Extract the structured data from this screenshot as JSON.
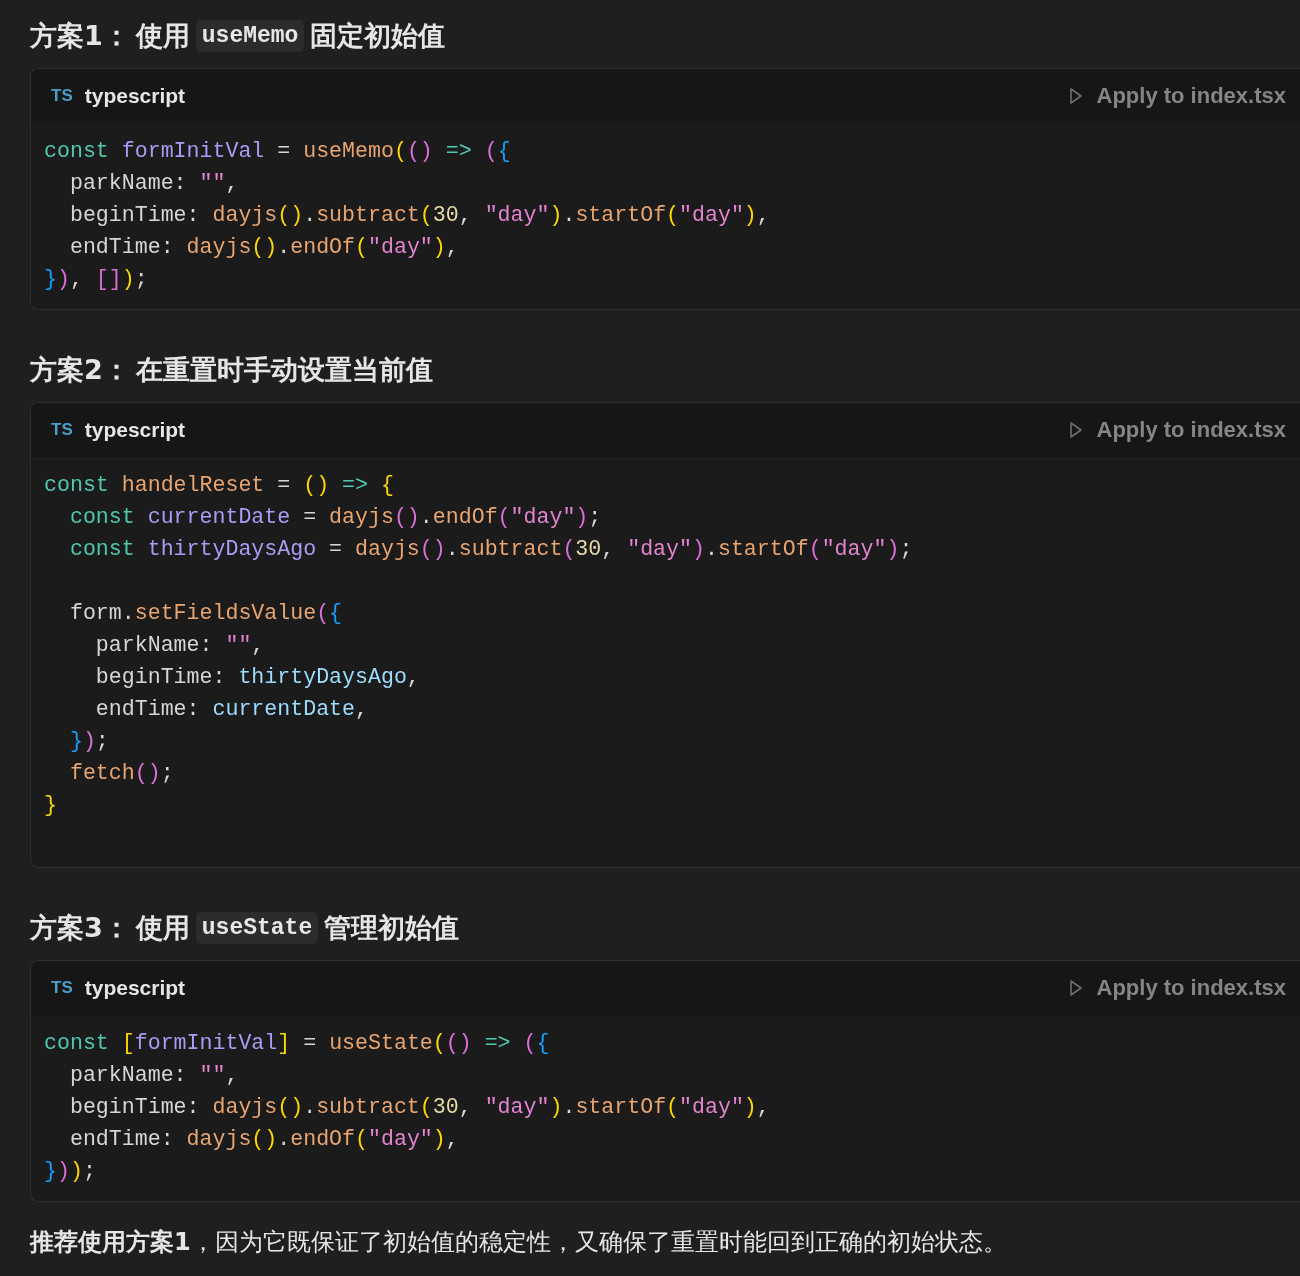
{
  "sections": [
    {
      "heading": [
        {
          "kind": "text",
          "text": "方案1："
        },
        {
          "kind": "text",
          "text": "使用"
        },
        {
          "kind": "code",
          "text": "useMemo"
        },
        {
          "kind": "text",
          "text": "固定初始值"
        }
      ],
      "block": {
        "badge": "TS",
        "language": "typescript",
        "apply": "Apply to index.tsx",
        "lines": [
          {
            "kind": "code",
            "tokens": [
              {
                "kind": "kw",
                "text": "const "
              },
              {
                "kind": "var",
                "text": "formInitVal"
              },
              {
                "kind": "plain",
                "text": " = "
              },
              {
                "kind": "fn",
                "text": "useMemo"
              },
              {
                "kind": "b1",
                "text": "("
              },
              {
                "kind": "b2",
                "text": "()"
              },
              {
                "kind": "kw",
                "text": " => "
              },
              {
                "kind": "b2",
                "text": "("
              },
              {
                "kind": "b3",
                "text": "{"
              }
            ]
          },
          {
            "kind": "code",
            "tokens": [
              {
                "kind": "plain",
                "text": "  parkName: "
              },
              {
                "kind": "str",
                "text": "\"\""
              },
              {
                "kind": "plain",
                "text": ","
              }
            ]
          },
          {
            "kind": "code",
            "tokens": [
              {
                "kind": "plain",
                "text": "  beginTime: "
              },
              {
                "kind": "fn",
                "text": "dayjs"
              },
              {
                "kind": "b1",
                "text": "()"
              },
              {
                "kind": "plain",
                "text": "."
              },
              {
                "kind": "fn",
                "text": "subtract"
              },
              {
                "kind": "b1",
                "text": "("
              },
              {
                "kind": "num",
                "text": "30"
              },
              {
                "kind": "plain",
                "text": ", "
              },
              {
                "kind": "str",
                "text": "\"day\""
              },
              {
                "kind": "b1",
                "text": ")"
              },
              {
                "kind": "plain",
                "text": "."
              },
              {
                "kind": "fn",
                "text": "startOf"
              },
              {
                "kind": "b1",
                "text": "("
              },
              {
                "kind": "str",
                "text": "\"day\""
              },
              {
                "kind": "b1",
                "text": ")"
              },
              {
                "kind": "plain",
                "text": ","
              }
            ]
          },
          {
            "kind": "code",
            "tokens": [
              {
                "kind": "plain",
                "text": "  endTime: "
              },
              {
                "kind": "fn",
                "text": "dayjs"
              },
              {
                "kind": "b1",
                "text": "()"
              },
              {
                "kind": "plain",
                "text": "."
              },
              {
                "kind": "fn",
                "text": "endOf"
              },
              {
                "kind": "b1",
                "text": "("
              },
              {
                "kind": "str",
                "text": "\"day\""
              },
              {
                "kind": "b1",
                "text": ")"
              },
              {
                "kind": "plain",
                "text": ","
              }
            ]
          },
          {
            "kind": "code",
            "tokens": [
              {
                "kind": "b3",
                "text": "}"
              },
              {
                "kind": "b2",
                "text": ")"
              },
              {
                "kind": "plain",
                "text": ", "
              },
              {
                "kind": "b2",
                "text": "[]"
              },
              {
                "kind": "b1",
                "text": ")"
              },
              {
                "kind": "plain",
                "text": ";"
              }
            ]
          }
        ]
      }
    },
    {
      "heading": [
        {
          "kind": "text",
          "text": "方案2："
        },
        {
          "kind": "text",
          "text": "在重置时手动设置当前值"
        }
      ],
      "block": {
        "badge": "TS",
        "language": "typescript",
        "apply": "Apply to index.tsx",
        "lines": [
          {
            "kind": "code",
            "tokens": [
              {
                "kind": "kw",
                "text": "const "
              },
              {
                "kind": "fn",
                "text": "handelReset"
              },
              {
                "kind": "plain",
                "text": " = "
              },
              {
                "kind": "b1",
                "text": "()"
              },
              {
                "kind": "kw",
                "text": " => "
              },
              {
                "kind": "b1",
                "text": "{"
              }
            ]
          },
          {
            "kind": "code",
            "tokens": [
              {
                "kind": "kw",
                "text": "  const "
              },
              {
                "kind": "var",
                "text": "currentDate"
              },
              {
                "kind": "plain",
                "text": " = "
              },
              {
                "kind": "fn",
                "text": "dayjs"
              },
              {
                "kind": "b2",
                "text": "()"
              },
              {
                "kind": "plain",
                "text": "."
              },
              {
                "kind": "fn",
                "text": "endOf"
              },
              {
                "kind": "b2",
                "text": "("
              },
              {
                "kind": "str",
                "text": "\"day\""
              },
              {
                "kind": "b2",
                "text": ")"
              },
              {
                "kind": "plain",
                "text": ";"
              }
            ]
          },
          {
            "kind": "code",
            "tokens": [
              {
                "kind": "kw",
                "text": "  const "
              },
              {
                "kind": "var",
                "text": "thirtyDaysAgo"
              },
              {
                "kind": "plain",
                "text": " = "
              },
              {
                "kind": "fn",
                "text": "dayjs"
              },
              {
                "kind": "b2",
                "text": "()"
              },
              {
                "kind": "plain",
                "text": "."
              },
              {
                "kind": "fn",
                "text": "subtract"
              },
              {
                "kind": "b2",
                "text": "("
              },
              {
                "kind": "num",
                "text": "30"
              },
              {
                "kind": "plain",
                "text": ", "
              },
              {
                "kind": "str",
                "text": "\"day\""
              },
              {
                "kind": "b2",
                "text": ")"
              },
              {
                "kind": "plain",
                "text": "."
              },
              {
                "kind": "fn",
                "text": "startOf"
              },
              {
                "kind": "b2",
                "text": "("
              },
              {
                "kind": "str",
                "text": "\"day\""
              },
              {
                "kind": "b2",
                "text": ")"
              },
              {
                "kind": "plain",
                "text": ";"
              }
            ]
          },
          {
            "kind": "blank"
          },
          {
            "kind": "code",
            "tokens": [
              {
                "kind": "plain",
                "text": "  form."
              },
              {
                "kind": "fn",
                "text": "setFieldsValue"
              },
              {
                "kind": "b2",
                "text": "("
              },
              {
                "kind": "b3",
                "text": "{"
              }
            ]
          },
          {
            "kind": "code",
            "tokens": [
              {
                "kind": "plain",
                "text": "    parkName: "
              },
              {
                "kind": "str",
                "text": "\"\""
              },
              {
                "kind": "plain",
                "text": ","
              }
            ]
          },
          {
            "kind": "code",
            "tokens": [
              {
                "kind": "plain",
                "text": "    beginTime: "
              },
              {
                "kind": "ref",
                "text": "thirtyDaysAgo"
              },
              {
                "kind": "plain",
                "text": ","
              }
            ]
          },
          {
            "kind": "code",
            "tokens": [
              {
                "kind": "plain",
                "text": "    endTime: "
              },
              {
                "kind": "ref",
                "text": "currentDate"
              },
              {
                "kind": "plain",
                "text": ","
              }
            ]
          },
          {
            "kind": "code",
            "tokens": [
              {
                "kind": "b3",
                "text": "  }"
              },
              {
                "kind": "b2",
                "text": ")"
              },
              {
                "kind": "plain",
                "text": ";"
              }
            ]
          },
          {
            "kind": "code",
            "tokens": [
              {
                "kind": "fn",
                "text": "  fetch"
              },
              {
                "kind": "b2",
                "text": "()"
              },
              {
                "kind": "plain",
                "text": ";"
              }
            ]
          },
          {
            "kind": "code",
            "tokens": [
              {
                "kind": "b1",
                "text": "}"
              }
            ]
          },
          {
            "kind": "blank"
          }
        ]
      }
    },
    {
      "heading": [
        {
          "kind": "text",
          "text": "方案3："
        },
        {
          "kind": "text",
          "text": "使用"
        },
        {
          "kind": "code",
          "text": "useState"
        },
        {
          "kind": "text",
          "text": "管理初始值"
        }
      ],
      "block": {
        "badge": "TS",
        "language": "typescript",
        "apply": "Apply to index.tsx",
        "lines": [
          {
            "kind": "code",
            "tokens": [
              {
                "kind": "kw",
                "text": "const "
              },
              {
                "kind": "b1",
                "text": "["
              },
              {
                "kind": "var",
                "text": "formInitVal"
              },
              {
                "kind": "b1",
                "text": "]"
              },
              {
                "kind": "plain",
                "text": " = "
              },
              {
                "kind": "fn",
                "text": "useState"
              },
              {
                "kind": "b1",
                "text": "("
              },
              {
                "kind": "b2",
                "text": "()"
              },
              {
                "kind": "kw",
                "text": " => "
              },
              {
                "kind": "b2",
                "text": "("
              },
              {
                "kind": "b3",
                "text": "{"
              }
            ]
          },
          {
            "kind": "code",
            "tokens": [
              {
                "kind": "plain",
                "text": "  parkName: "
              },
              {
                "kind": "str",
                "text": "\"\""
              },
              {
                "kind": "plain",
                "text": ","
              }
            ]
          },
          {
            "kind": "code",
            "tokens": [
              {
                "kind": "plain",
                "text": "  beginTime: "
              },
              {
                "kind": "fn",
                "text": "dayjs"
              },
              {
                "kind": "b1",
                "text": "()"
              },
              {
                "kind": "plain",
                "text": "."
              },
              {
                "kind": "fn",
                "text": "subtract"
              },
              {
                "kind": "b1",
                "text": "("
              },
              {
                "kind": "num",
                "text": "30"
              },
              {
                "kind": "plain",
                "text": ", "
              },
              {
                "kind": "str",
                "text": "\"day\""
              },
              {
                "kind": "b1",
                "text": ")"
              },
              {
                "kind": "plain",
                "text": "."
              },
              {
                "kind": "fn",
                "text": "startOf"
              },
              {
                "kind": "b1",
                "text": "("
              },
              {
                "kind": "str",
                "text": "\"day\""
              },
              {
                "kind": "b1",
                "text": ")"
              },
              {
                "kind": "plain",
                "text": ","
              }
            ]
          },
          {
            "kind": "code",
            "tokens": [
              {
                "kind": "plain",
                "text": "  endTime: "
              },
              {
                "kind": "fn",
                "text": "dayjs"
              },
              {
                "kind": "b1",
                "text": "()"
              },
              {
                "kind": "plain",
                "text": "."
              },
              {
                "kind": "fn",
                "text": "endOf"
              },
              {
                "kind": "b1",
                "text": "("
              },
              {
                "kind": "str",
                "text": "\"day\""
              },
              {
                "kind": "b1",
                "text": ")"
              },
              {
                "kind": "plain",
                "text": ","
              }
            ]
          },
          {
            "kind": "code",
            "tokens": [
              {
                "kind": "b3",
                "text": "}"
              },
              {
                "kind": "b2",
                "text": ")"
              },
              {
                "kind": "b1",
                "text": ")"
              },
              {
                "kind": "plain",
                "text": ";"
              }
            ]
          }
        ]
      }
    }
  ],
  "conclusion": "**推荐使用方案1**，因为它既保证了初始值的稳定性，又确保了重置时能回到正确的初始状态。"
}
